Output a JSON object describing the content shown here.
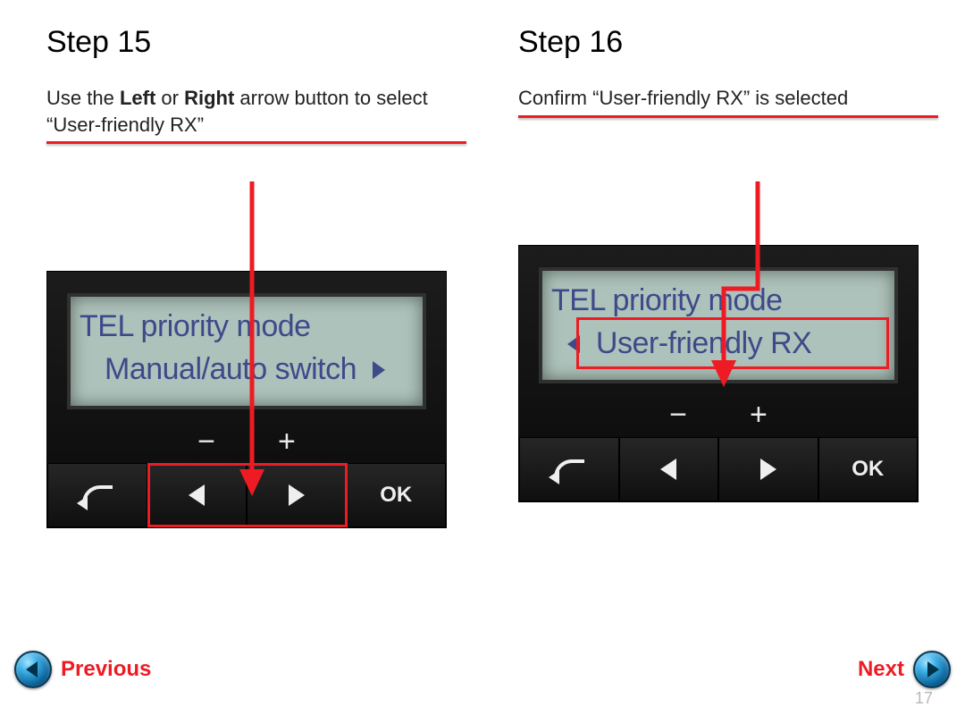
{
  "pageNumber": "17",
  "nav": {
    "prev": "Previous",
    "next": "Next"
  },
  "left": {
    "title": "Step 15",
    "instr_pre": "Use the ",
    "instr_b1": "Left",
    "instr_mid": " or ",
    "instr_b2": "Right",
    "instr_post": " arrow button to select “User-friendly RX”",
    "lcd": {
      "line1": "TEL priority mode",
      "line2": "Manual/auto switch"
    },
    "minus": "−",
    "plus": "+",
    "ok": "OK"
  },
  "right": {
    "title": "Step 16",
    "instr": "Confirm “User-friendly RX” is selected",
    "lcd": {
      "line1": "TEL priority mode",
      "line2": "User-friendly RX"
    },
    "minus": "−",
    "plus": "+",
    "ok": "OK"
  }
}
